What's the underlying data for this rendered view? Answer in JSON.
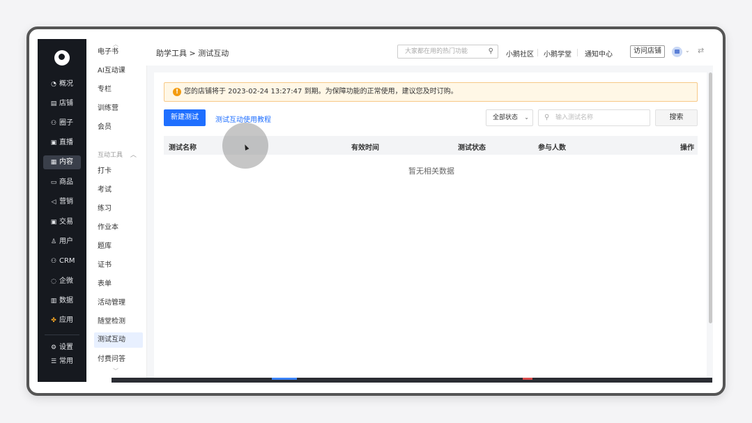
{
  "nav": {
    "items": [
      {
        "label": "概况",
        "icon": "pie-chart-icon",
        "active": false
      },
      {
        "label": "店铺",
        "icon": "store-icon",
        "active": false
      },
      {
        "label": "圈子",
        "icon": "group-icon",
        "active": false
      },
      {
        "label": "直播",
        "icon": "live-icon",
        "active": false
      },
      {
        "label": "内容",
        "icon": "content-icon",
        "active": true
      },
      {
        "label": "商品",
        "icon": "goods-icon",
        "active": false
      },
      {
        "label": "营销",
        "icon": "megaphone-icon",
        "active": false
      },
      {
        "label": "交易",
        "icon": "trade-icon",
        "active": false
      },
      {
        "label": "用户",
        "icon": "user-icon",
        "active": false
      },
      {
        "label": "CRM",
        "icon": "crm-icon",
        "active": false
      },
      {
        "label": "企微",
        "icon": "wecom-icon",
        "active": false
      },
      {
        "label": "数据",
        "icon": "data-icon",
        "active": false
      },
      {
        "label": "应用",
        "icon": "apps-icon",
        "active": false
      }
    ],
    "bottom": [
      {
        "label": "设置",
        "icon": "gear-icon"
      },
      {
        "label": "常用",
        "icon": "list-icon"
      }
    ]
  },
  "submenu": {
    "items_top": [
      "电子书",
      "AI互动课",
      "专栏",
      "训练营",
      "会员"
    ],
    "group_label": "互动工具",
    "items_group": [
      "打卡",
      "考试",
      "练习",
      "作业本",
      "题库",
      "证书",
      "表单",
      "活动管理",
      "随堂检测",
      "测试互动",
      "付费问答"
    ],
    "active": "测试互动"
  },
  "header": {
    "breadcrumb": "助学工具 > 测试互动",
    "search_placeholder": "大家都在用的热门功能",
    "links": [
      "小鹅社区",
      "小鹅学堂",
      "通知中心"
    ],
    "visit_store": "访问店铺"
  },
  "main": {
    "alert_text": "您的店铺将于 2023-02-24 13:27:47 到期。为保障功能的正常使用，建议您及时订购。",
    "new_button": "新建测试",
    "tutorial_link": "测试互动使用教程",
    "status_select": "全部状态",
    "search_placeholder": "输入测试名称",
    "search_button": "搜索",
    "columns": [
      "测试名称",
      "有效时间",
      "测试状态",
      "参与人数",
      "操作"
    ],
    "empty_text": "暂无相关数据"
  },
  "colors": {
    "primary": "#1f6fff",
    "nav_bg": "#16191f",
    "warning": "#f39c12"
  }
}
